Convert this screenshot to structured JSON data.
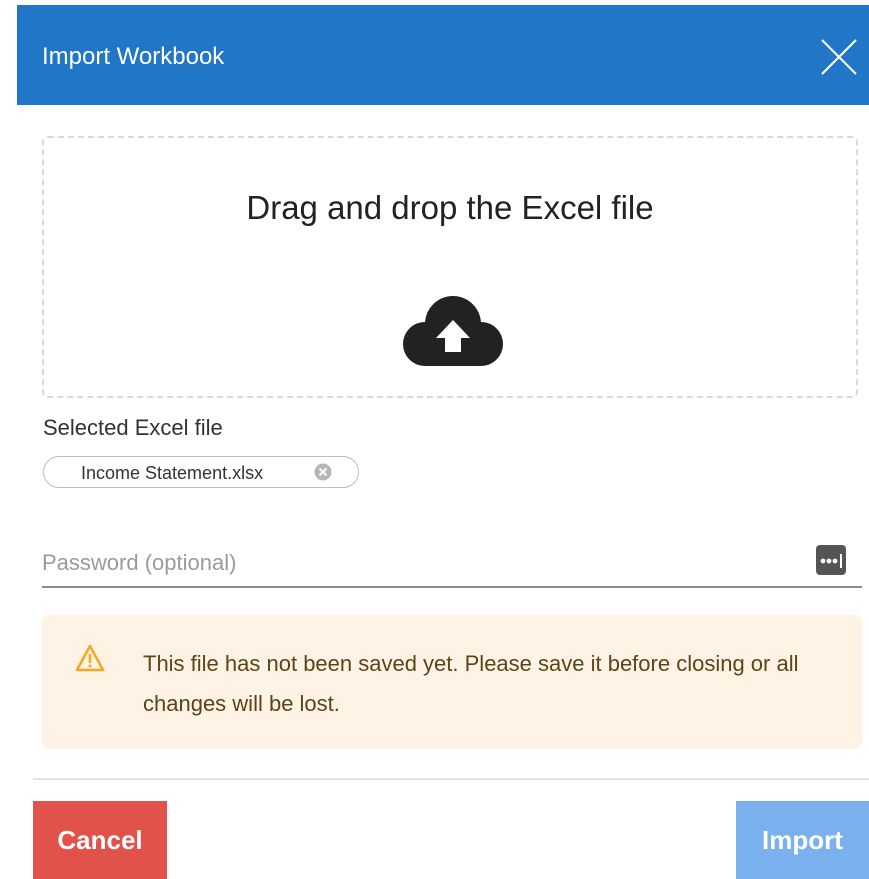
{
  "dialog": {
    "title": "Import Workbook"
  },
  "dropzone": {
    "text": "Drag and drop the Excel file"
  },
  "selected_file": {
    "label": "Selected Excel file",
    "file_name": "Income Statement.xlsx"
  },
  "password": {
    "placeholder": "Password (optional)",
    "value": ""
  },
  "warning": {
    "text": "This file has not been saved yet. Please save it before closing or all changes will be lost."
  },
  "footer": {
    "cancel_label": "Cancel",
    "import_label": "Import"
  },
  "icons": {
    "close": "close-icon",
    "upload": "cloud-upload-icon",
    "chip_remove": "remove-circle-icon",
    "password_toggle": "password-dots-icon",
    "warning": "warning-triangle-icon"
  },
  "colors": {
    "header_bg": "#2176c7",
    "cancel_bg": "#e0524a",
    "import_bg": "#7bb0ef",
    "warning_bg": "#fff3e6",
    "warning_icon": "#f5a623",
    "warning_text": "#5c4417"
  }
}
